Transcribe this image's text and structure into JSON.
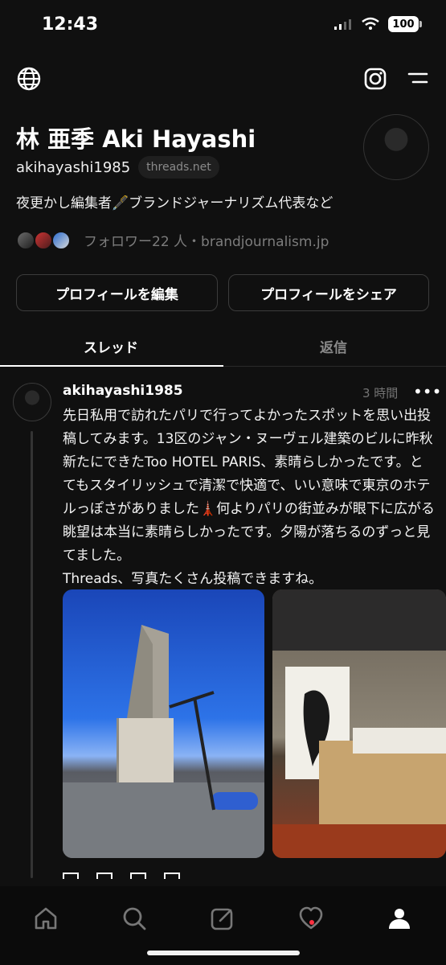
{
  "status": {
    "time": "12:43",
    "battery": "100"
  },
  "profile": {
    "name": "林 亜季 Aki Hayashi",
    "handle": "akihayashi1985",
    "domain_chip": "threads.net",
    "bio": "夜更かし編集者🖋️ブランドジャーナリズム代表など",
    "followers_line": "フォロワー22 人・brandjournalism.jp"
  },
  "buttons": {
    "edit": "プロフィールを編集",
    "share": "プロフィールをシェア"
  },
  "tabs": [
    {
      "label": "スレッド"
    },
    {
      "label": "返信"
    }
  ],
  "post": {
    "username": "akihayashi1985",
    "time": "3 時間",
    "more": "•••",
    "text": "先日私用で訪れたパリで行ってよかったスポットを思い出投稿してみます。13区のジャン・ヌーヴェル建築のビルに昨秋新たにできたToo HOTEL PARIS、素晴らしかったです。とてもスタイリッシュで清潔で快適で、いい意味で東京のホテルっぽさがありました🗼何よりパリの街並みが眼下に広がる眺望は本当に素晴らしかったです。夕陽が落ちるのずっと見てました。\nThreads、写真たくさん投稿できますね。"
  },
  "icons": {
    "globe": "globe-icon",
    "instagram": "instagram-icon",
    "menu": "menu-icon",
    "home": "home-icon",
    "search": "search-icon",
    "compose": "compose-icon",
    "heart": "heart-icon",
    "profile": "profile-icon"
  },
  "colors": {
    "background": "#101010",
    "text": "#ffffff",
    "secondary": "#7c7c7c",
    "notification": "#ff3040"
  }
}
